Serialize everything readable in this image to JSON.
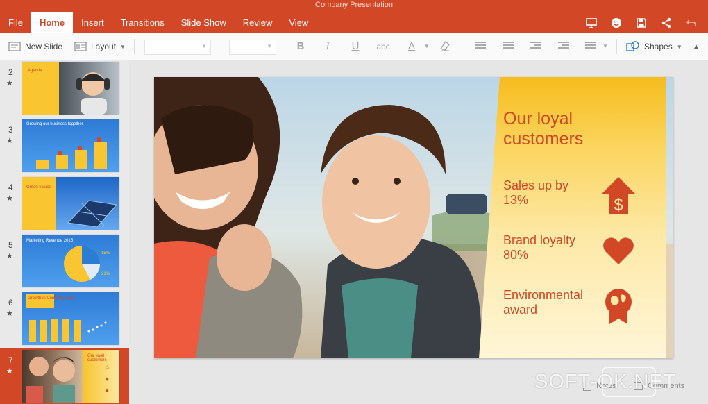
{
  "window": {
    "title": "Company Presentation"
  },
  "tabs": [
    "File",
    "Home",
    "Insert",
    "Transitions",
    "Slide Show",
    "Review",
    "View"
  ],
  "active_tab": "Home",
  "quick_actions": [
    "present-icon",
    "smiley-icon",
    "save-icon",
    "share-icon",
    "undo-icon"
  ],
  "ribbon": {
    "new_slide": "New Slide",
    "layout": "Layout",
    "font_name": "",
    "font_size": "",
    "format_buttons": [
      "B",
      "I",
      "U",
      "abc",
      "A"
    ],
    "shapes": "Shapes"
  },
  "thumbnails": [
    {
      "num": "2",
      "star": "★",
      "title": "Agenda"
    },
    {
      "num": "3",
      "star": "★",
      "title": "Growing our business together"
    },
    {
      "num": "4",
      "star": "★",
      "title": "Green values"
    },
    {
      "num": "5",
      "star": "★",
      "title": "Marketing Revenue 2015",
      "pct1": "15%",
      "pct2": "21%"
    },
    {
      "num": "6",
      "star": "★",
      "title": "Growth in Company sales"
    },
    {
      "num": "7",
      "star": "★",
      "title": "Our loyal customers",
      "selected": true
    }
  ],
  "slide": {
    "headline_line1": "Our loyal",
    "headline_line2": "customers",
    "stats": [
      {
        "line1": "Sales up by",
        "line2": "13%",
        "icon": "dollar-house-icon"
      },
      {
        "line1": "Brand loyalty",
        "line2": "80%",
        "icon": "heart-icon"
      },
      {
        "line1": "Environmental",
        "line2": "award",
        "icon": "globe-award-icon"
      }
    ]
  },
  "status": {
    "notes": "Notes",
    "comments": "Comments"
  },
  "watermark": "SOFT-OK.NET",
  "colors": {
    "accent": "#d24726",
    "panel": "#f6bc1e"
  }
}
